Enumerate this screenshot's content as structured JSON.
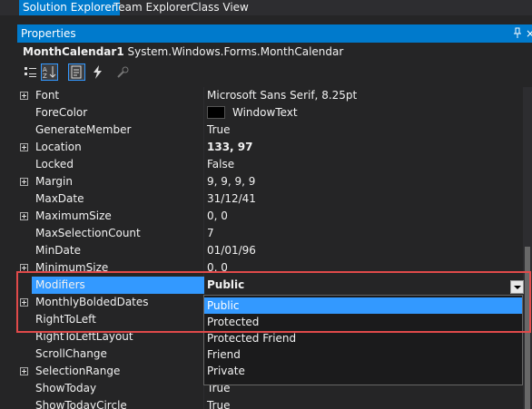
{
  "tabs": [
    {
      "label": "Solution Explorer",
      "active": true
    },
    {
      "label": "Team Explorer",
      "active": false
    },
    {
      "label": "Class View",
      "active": false
    }
  ],
  "panel": {
    "title": "Properties",
    "pin_icon": "pin-icon",
    "close_glyph": "×"
  },
  "object": {
    "name": "MonthCalendar1",
    "type": "System.Windows.Forms.MonthCalendar"
  },
  "toolbar": [
    "categorized-icon",
    "alphabetical-icon",
    "properties-icon",
    "events-icon",
    "property-pages-icon"
  ],
  "properties": [
    {
      "name": "Font",
      "value": "Microsoft Sans Serif, 8.25pt",
      "expandable": true
    },
    {
      "name": "ForeColor",
      "value": "WindowText",
      "swatch": "#000000"
    },
    {
      "name": "GenerateMember",
      "value": "True"
    },
    {
      "name": "Location",
      "value": "133, 97",
      "expandable": true,
      "bold": true
    },
    {
      "name": "Locked",
      "value": "False"
    },
    {
      "name": "Margin",
      "value": "9, 9, 9, 9",
      "expandable": true
    },
    {
      "name": "MaxDate",
      "value": "31/12/41"
    },
    {
      "name": "MaximumSize",
      "value": "0, 0",
      "expandable": true
    },
    {
      "name": "MaxSelectionCount",
      "value": "7"
    },
    {
      "name": "MinDate",
      "value": "01/01/96"
    },
    {
      "name": "MinimumSize",
      "value": "0, 0",
      "expandable": true
    },
    {
      "name": "Modifiers",
      "value": "Public",
      "bold": true,
      "selected": true
    },
    {
      "name": "MonthlyBoldedDates",
      "value": "",
      "expandable": true
    },
    {
      "name": "RightToLeft",
      "value": ""
    },
    {
      "name": "RightToLeftLayout",
      "value": ""
    },
    {
      "name": "ScrollChange",
      "value": ""
    },
    {
      "name": "SelectionRange",
      "value": "",
      "expandable": true
    },
    {
      "name": "ShowToday",
      "value": "True"
    },
    {
      "name": "ShowTodayCircle",
      "value": "True"
    }
  ],
  "dropdown": {
    "options": [
      "Public",
      "Protected",
      "Protected Friend",
      "Friend",
      "Private"
    ],
    "highlighted": "Public"
  },
  "colors": {
    "accent": "#007acc",
    "selection": "#3399ff",
    "highlight_box": "#e04a4a"
  }
}
